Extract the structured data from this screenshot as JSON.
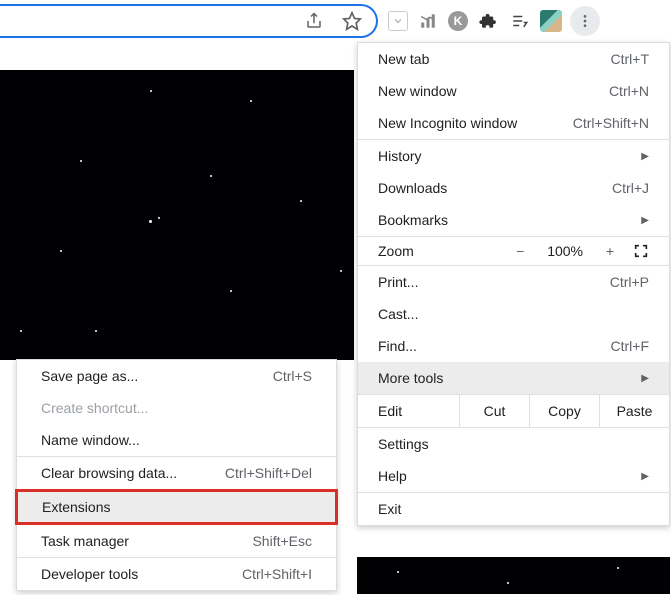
{
  "menu": {
    "new_tab": "New tab",
    "new_tab_sc": "Ctrl+T",
    "new_window": "New window",
    "new_window_sc": "Ctrl+N",
    "incognito": "New Incognito window",
    "incognito_sc": "Ctrl+Shift+N",
    "history": "History",
    "downloads": "Downloads",
    "downloads_sc": "Ctrl+J",
    "bookmarks": "Bookmarks",
    "zoom": "Zoom",
    "zoom_val": "100%",
    "print": "Print...",
    "print_sc": "Ctrl+P",
    "cast": "Cast...",
    "find": "Find...",
    "find_sc": "Ctrl+F",
    "more_tools": "More tools",
    "edit": "Edit",
    "cut": "Cut",
    "copy": "Copy",
    "paste": "Paste",
    "settings": "Settings",
    "help": "Help",
    "exit": "Exit"
  },
  "submenu": {
    "save_page": "Save page as...",
    "save_page_sc": "Ctrl+S",
    "create_shortcut": "Create shortcut...",
    "name_window": "Name window...",
    "clear_data": "Clear browsing data...",
    "clear_data_sc": "Ctrl+Shift+Del",
    "extensions": "Extensions",
    "task_manager": "Task manager",
    "task_manager_sc": "Shift+Esc",
    "dev_tools": "Developer tools",
    "dev_tools_sc": "Ctrl+Shift+I"
  }
}
